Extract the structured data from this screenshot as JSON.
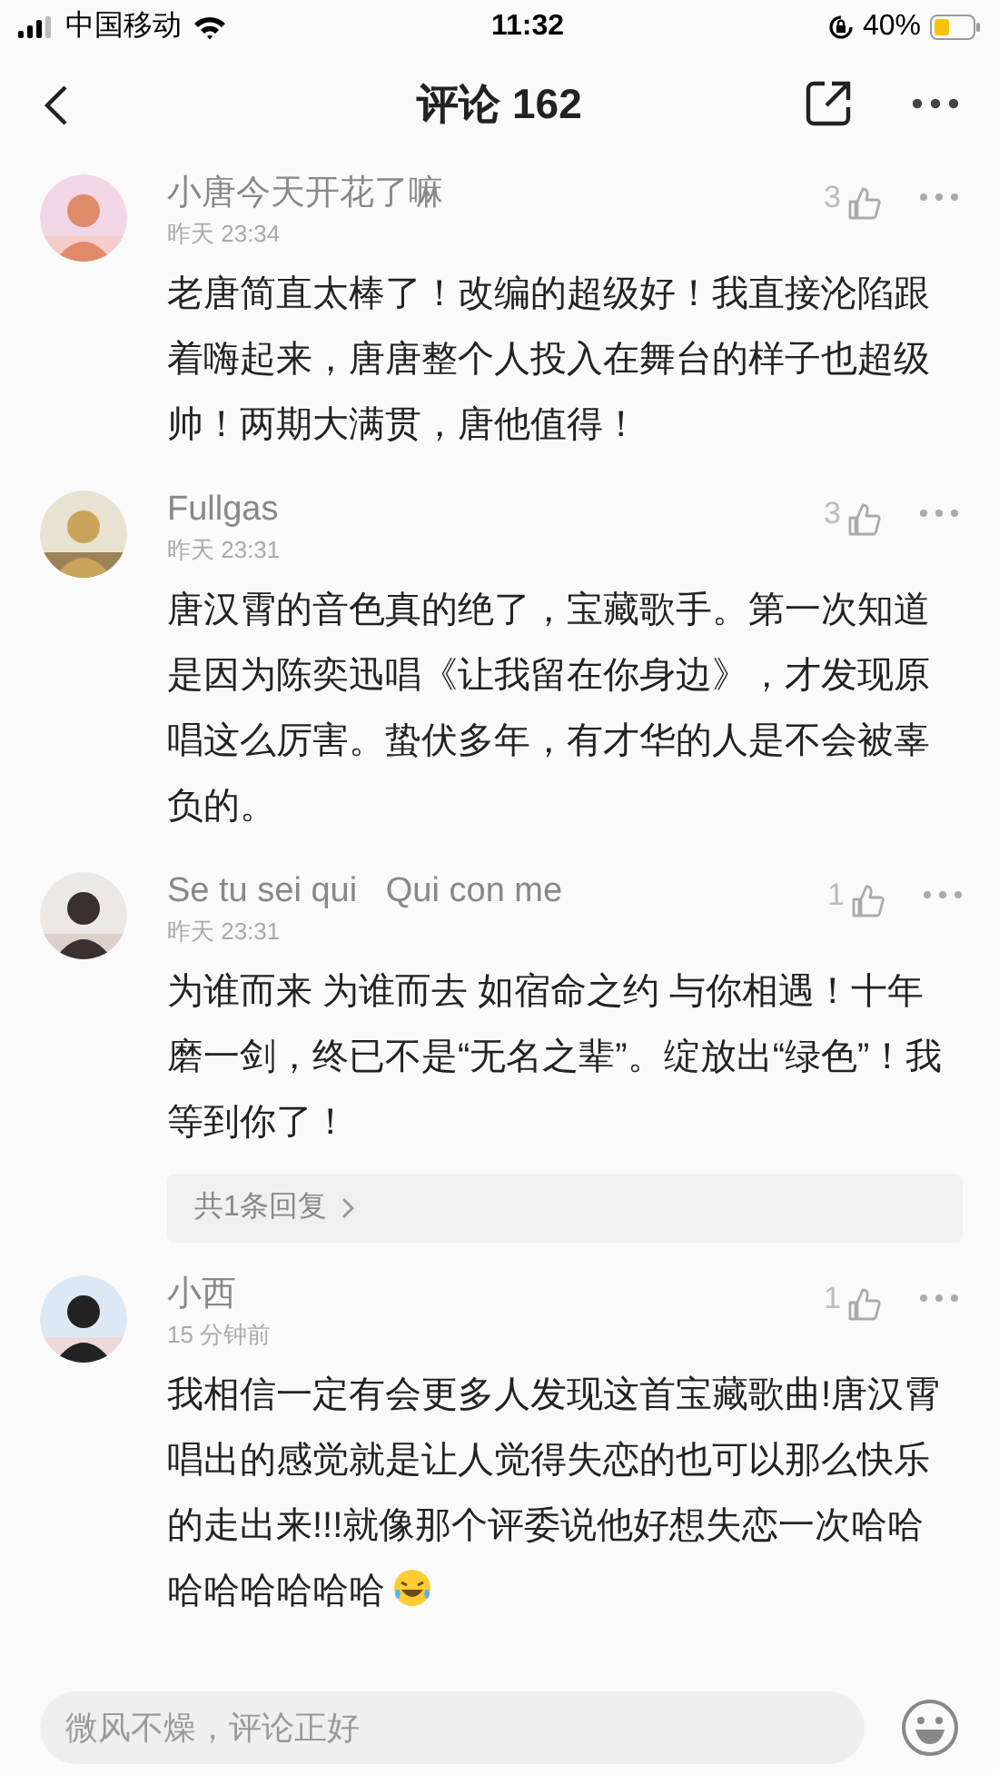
{
  "status_bar": {
    "carrier": "中国移动",
    "time": "11:32",
    "battery": "40%"
  },
  "header": {
    "title": "评论 162"
  },
  "comments": [
    {
      "author": "小唐今天开花了嘛",
      "time": "昨天 23:34",
      "likes": "3",
      "text": "老唐简直太棒了！改编的超级好！我直接沦陷跟着嗨起来，唐唐整个人投入在舞台的样子也超级帅！两期大满贯，唐他值得！"
    },
    {
      "author": "Fullgas",
      "time": "昨天 23:31",
      "likes": "3",
      "text": "唐汉霄的音色真的绝了，宝藏歌手。第一次知道是因为陈奕迅唱《让我留在你身边》，才发现原唱这么厉害。蛰伏多年，有才华的人是不会被辜负的。"
    },
    {
      "author": "Se tu sei qui   Qui con me",
      "time": "昨天 23:31",
      "likes": "1",
      "text": "为谁而来 为谁而去 如宿命之约 与你相遇！十年磨一剑，终已不是“无名之辈”。绽放出“绿色”！我等到你了！",
      "replies": "共1条回复"
    },
    {
      "author": "小西",
      "time": "15 分钟前",
      "likes": "1",
      "text": "我相信一定有会更多人发现这首宝藏歌曲!唐汉霄唱出的感觉就是让人觉得失恋的也可以那么快乐的走出来!!!就像那个评委说他好想失恋一次哈哈哈哈哈哈哈哈",
      "emoji": true
    }
  ],
  "input": {
    "placeholder": "微风不燥，评论正好"
  }
}
